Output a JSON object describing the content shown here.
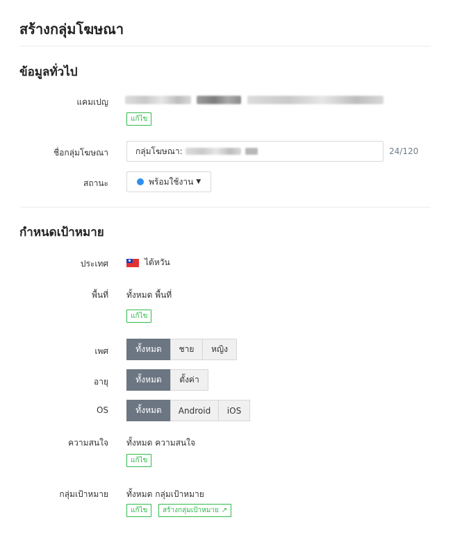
{
  "page_title": "สร้างกลุ่มโฆษณา",
  "general": {
    "title": "ข้อมูลทั่วไป",
    "campaign": {
      "label": "แคมเปญ",
      "edit": "แก้ไข"
    },
    "group_name": {
      "label": "ชื่อกลุ่มโฆษณา",
      "value": "กลุ่มโฆษณา:",
      "counter": "24/120"
    },
    "status": {
      "label": "สถานะ",
      "value": "พร้อมใช้งาน",
      "dot_color": "#2e8ff0"
    }
  },
  "targeting": {
    "title": "กำหนดเป้าหมาย",
    "country": {
      "label": "ประเทศ",
      "value": "ไต้หวัน",
      "icon": "taiwan-flag-icon"
    },
    "area": {
      "label": "พื้นที่",
      "value": "ทั้งหมด พื้นที่",
      "edit": "แก้ไข"
    },
    "gender": {
      "label": "เพศ",
      "options": [
        "ทั้งหมด",
        "ชาย",
        "หญิง"
      ],
      "selected": "ทั้งหมด"
    },
    "age": {
      "label": "อายุ",
      "options": [
        "ทั้งหมด",
        "ตั้งค่า"
      ],
      "selected": "ทั้งหมด"
    },
    "os": {
      "label": "OS",
      "options": [
        "ทั้งหมด",
        "Android",
        "iOS"
      ],
      "selected": "ทั้งหมด"
    },
    "interest": {
      "label": "ความสนใจ",
      "value": "ทั้งหมด ความสนใจ",
      "edit": "แก้ไข"
    },
    "audience": {
      "label": "กลุ่มเป้าหมาย",
      "value": "ทั้งหมด กลุ่มเป้าหมาย",
      "edit": "แก้ไข",
      "create": "สร้างกลุ่มเป้าหมาย"
    }
  },
  "colors": {
    "accent_green": "#2fb94b",
    "segment_active": "#6c7682",
    "counter": "#6b7c8c"
  }
}
